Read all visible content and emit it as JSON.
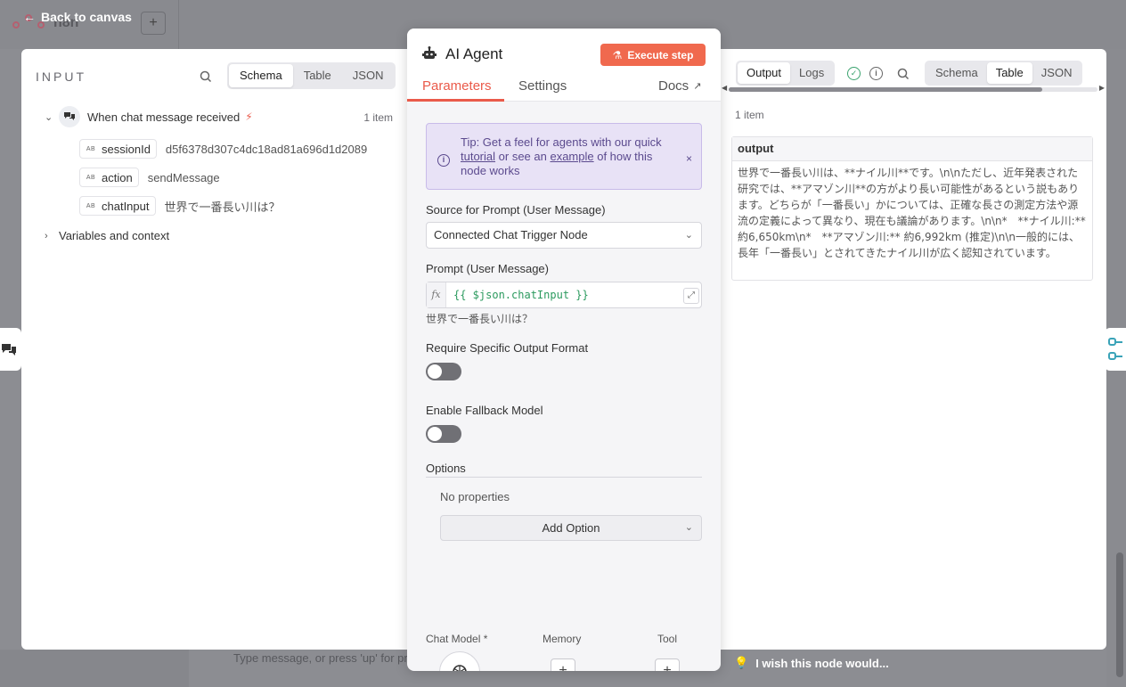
{
  "background": {
    "workflow_name": "n8n",
    "add_label": "+",
    "chat_hint": "Type message, or press 'up' for prev one",
    "wish_text": "I wish this node would..."
  },
  "back_link": {
    "label": "Back to canvas"
  },
  "input_panel": {
    "title": "INPUT",
    "view_tabs": [
      "Schema",
      "Table",
      "JSON"
    ],
    "active_tab": "Schema",
    "trigger": {
      "label": "When chat message received",
      "count": "1 item"
    },
    "fields": [
      {
        "type": "AB",
        "name": "sessionId",
        "value": "d5f6378d307c4dc18ad81a696d1d2089"
      },
      {
        "type": "AB",
        "name": "action",
        "value": "sendMessage"
      },
      {
        "type": "AB",
        "name": "chatInput",
        "value": "世界で一番長い川は？"
      }
    ],
    "variables_label": "Variables and context"
  },
  "node_panel": {
    "title": "AI Agent",
    "execute_label": "Execute step",
    "tabs": [
      "Parameters",
      "Settings"
    ],
    "active_tab": "Parameters",
    "docs_label": "Docs",
    "tip": {
      "prefix": "Tip: Get a feel for agents with our quick ",
      "link1": "tutorial",
      "middle": " or see an ",
      "link2": "example",
      "suffix": " of how this node works",
      "close": "×"
    },
    "source_label": "Source for Prompt (User Message)",
    "source_value": "Connected Chat Trigger Node",
    "prompt_label": "Prompt (User Message)",
    "prompt_fx": "fx",
    "prompt_expression": "{{ $json.chatInput }}",
    "prompt_preview": "世界で一番長い川は？",
    "require_format_label": "Require Specific Output Format",
    "require_format_enabled": false,
    "fallback_label": "Enable Fallback Model",
    "fallback_enabled": false,
    "options_label": "Options",
    "no_properties": "No properties",
    "add_option": "Add Option",
    "sub_nodes": [
      {
        "label": "Chat Model *"
      },
      {
        "label": "Memory"
      },
      {
        "label": "Tool"
      }
    ],
    "plus": "+"
  },
  "output_panel": {
    "tabs": [
      "Output",
      "Logs"
    ],
    "active_tab": "Output",
    "view_tabs": [
      "Schema",
      "Table",
      "JSON"
    ],
    "active_view": "Table",
    "count": "1 item",
    "column": "output",
    "cell_value": "世界で一番長い川は、**ナイル川**です。\\n\\nただし、近年発表された研究では、**アマゾン川**の方がより長い可能性があるという説もあります。どちらが「一番長い」かについては、正確な長さの測定方法や源流の定義によって異なり、現在も議論があります。\\n\\n*　**ナイル川:** 約6,650km\\n*　**アマゾン川:** 約6,992km (推定)\\n\\n一般的には、長年「一番長い」とされてきたナイル川が広く認知されています。"
  }
}
